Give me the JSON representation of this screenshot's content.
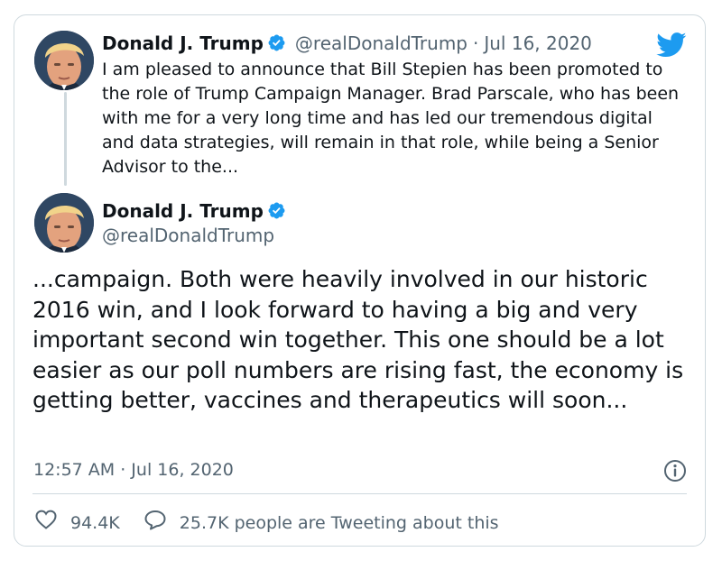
{
  "parent_tweet": {
    "name": "Donald J. Trump",
    "handle": "@realDonaldTrump",
    "separator": "·",
    "date": "Jul 16, 2020",
    "text": "I am pleased to announce that Bill Stepien has been promoted to the role of Trump Campaign Manager. Brad Parscale, who has been with me for a very long time and has led our tremendous digital and data strategies, will remain in that role, while being a Senior Advisor to the..."
  },
  "main_tweet": {
    "name": "Donald J. Trump",
    "handle": "@realDonaldTrump",
    "text": "...campaign. Both were heavily involved in our historic 2016 win, and I look forward to having a big and very important second win together. This one should be a lot easier as our poll numbers are rising fast, the economy is getting better, vaccines and therapeutics will soon...",
    "timestamp": "12:57 AM · Jul 16, 2020"
  },
  "stats": {
    "likes": "94.4K",
    "tweeting": "25.7K people are Tweeting about this"
  },
  "icons": {
    "brand": "twitter-bird-icon",
    "verified": "verified-badge-icon",
    "info": "info-icon",
    "like": "heart-icon",
    "reply": "speech-bubble-icon"
  },
  "colors": {
    "brand_blue": "#1d9bf0",
    "text": "#0f1419",
    "secondary": "#536471",
    "border": "#cfd9de"
  }
}
